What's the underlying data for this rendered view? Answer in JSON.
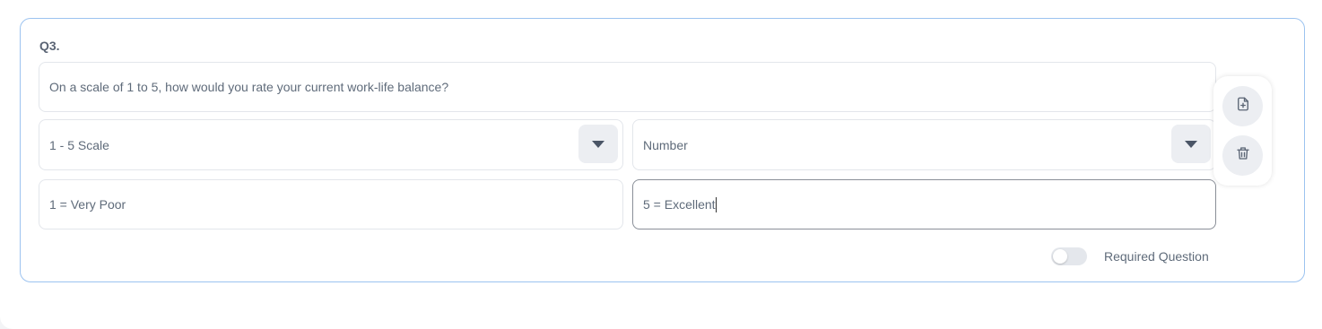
{
  "question": {
    "number_label": "Q3.",
    "text": "On a scale of 1 to 5, how would you rate your current work-life balance?"
  },
  "scale_select": {
    "selected": "1 - 5 Scale",
    "icon": "triangle-down-icon"
  },
  "type_select": {
    "selected": "Number",
    "icon": "triangle-down-icon"
  },
  "low_label": {
    "value": "1 = Very Poor"
  },
  "high_label": {
    "value": "5 = Excellent"
  },
  "side_actions": {
    "add_icon": "file-plus-icon",
    "delete_icon": "trash-icon"
  },
  "required": {
    "label": "Required Question",
    "enabled": false
  },
  "colors": {
    "card_border": "#9cc3f0",
    "text": "#5f6b7a",
    "button_bg": "#eceef2"
  }
}
